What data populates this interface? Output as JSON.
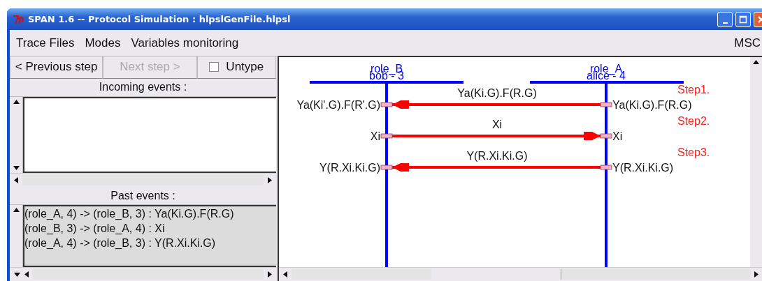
{
  "window": {
    "title": "SPAN 1.6 -- Protocol Simulation : hlpslGenFile.hlpsl"
  },
  "menu": {
    "items": [
      "Trace Files",
      "Modes",
      "Variables monitoring"
    ],
    "right_item": "MSC"
  },
  "toolbar": {
    "previous": {
      "label": "< Previous step",
      "disabled": false
    },
    "next": {
      "label": "Next step >",
      "disabled": true
    },
    "untype": {
      "label": "Untype",
      "checked": false
    }
  },
  "incoming_events": {
    "title": "Incoming events :"
  },
  "past_events": {
    "title": "Past events :",
    "items": [
      "(role_A, 4) -> (role_B, 3) : Ya(Ki.G).F(R.G)",
      "(role_B, 3) -> (role_A, 4) : Xi",
      "(role_A, 4) -> (role_B, 3) : Y(R.Xi.Ki.G)"
    ]
  },
  "msc": {
    "roles": [
      {
        "name": "role_B",
        "instance": "bob - 3"
      },
      {
        "name": "role_A",
        "instance": "alice - 4"
      }
    ],
    "messages": [
      {
        "label": "Ya(Ki.G).F(R.G)",
        "kind": "left",
        "left_text": "Ya(Ki'.G).F(R'.G)",
        "right_text": "Ya(Ki.G).F(R.G)",
        "step": "Step1."
      },
      {
        "label": "Xi",
        "kind": "right",
        "left_text": "Xi",
        "right_text": "Xi",
        "step": "Step2."
      },
      {
        "label": "Y(R.Xi.Ki.G)",
        "kind": "left",
        "left_text": "Y(R.Xi.Ki.G)",
        "right_text": "Y(R.Xi.Ki.G)",
        "step": "Step3."
      }
    ]
  }
}
